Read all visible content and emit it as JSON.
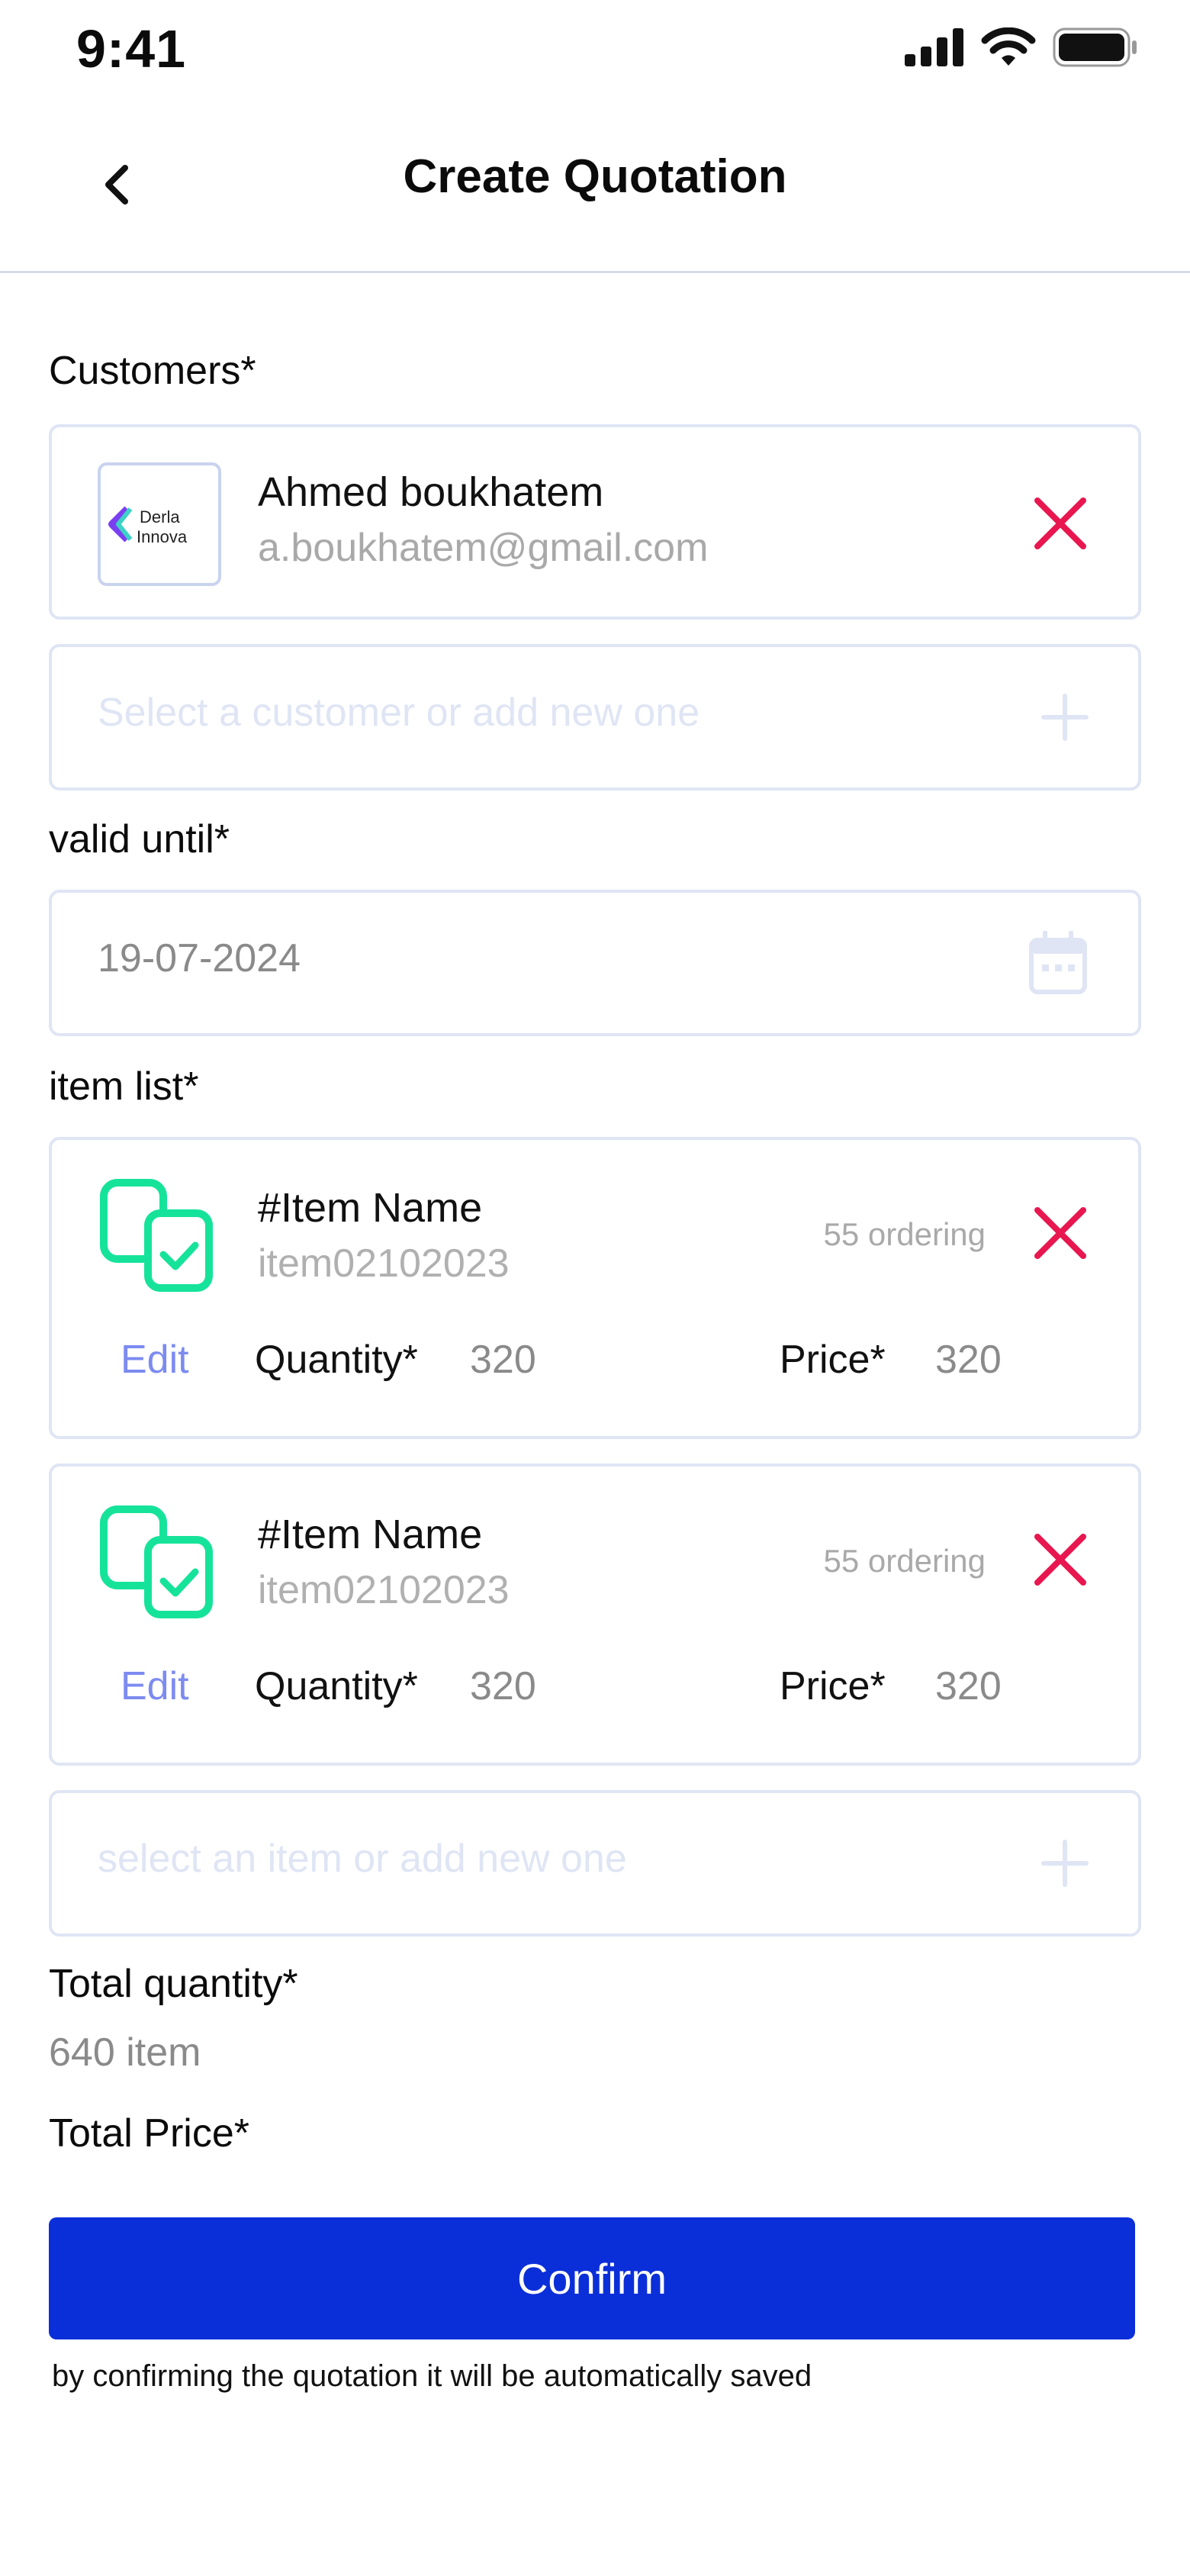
{
  "status_bar": {
    "time": "9:41",
    "icons": [
      "signal-icon",
      "wifi-icon",
      "battery-icon"
    ]
  },
  "header": {
    "title": "Create Quotation",
    "back_icon": "chevron-left-icon"
  },
  "customers": {
    "label": "Customers*",
    "selected": {
      "logo_text_line1": "Derla",
      "logo_text_line2": "Innova",
      "name": "Ahmed boukhatem",
      "email": "a.boukhatem@gmail.com"
    },
    "placeholder": "Select a customer or add new one"
  },
  "valid_until": {
    "label": "valid until*",
    "value": "19-07-2024"
  },
  "item_list": {
    "label": "item list*",
    "items": [
      {
        "name": "#Item Name",
        "code": "item02102023",
        "ordering": "55 ordering",
        "edit": "Edit",
        "quantity_label": "Quantity*",
        "quantity": "320",
        "price_label": "Price*",
        "price": "320"
      },
      {
        "name": "#Item Name",
        "code": "item02102023",
        "ordering": "55 ordering",
        "edit": "Edit",
        "quantity_label": "Quantity*",
        "quantity": "320",
        "price_label": "Price*",
        "price": "320"
      }
    ],
    "placeholder": "select an item or add new one"
  },
  "totals": {
    "quantity_label": "Total quantity*",
    "quantity_value": "640 item",
    "price_label": "Total Price*"
  },
  "confirm": {
    "label": "Confirm",
    "note": "by confirming the  quotation it will be automatically saved"
  },
  "colors": {
    "primary": "#0a2fd9",
    "danger": "#e8174f",
    "accent_green": "#16e39a",
    "link": "#7c8bf0",
    "border": "#dfe5f4"
  }
}
